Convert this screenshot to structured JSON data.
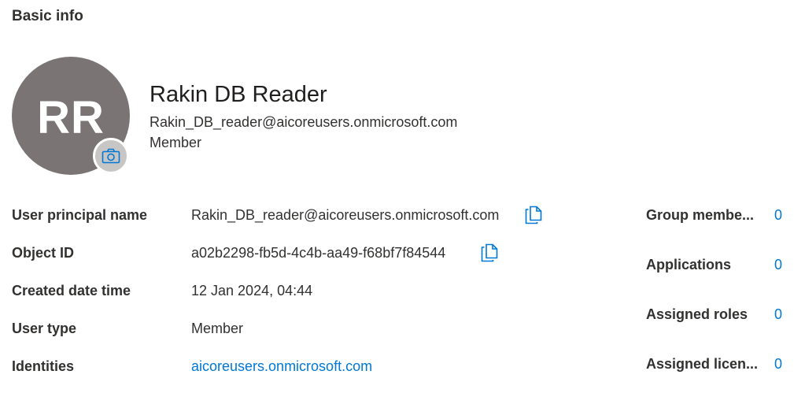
{
  "section": {
    "title": "Basic info"
  },
  "profile": {
    "initials": "RR",
    "name": "Rakin DB Reader",
    "email": "Rakin_DB_reader@aicoreusers.onmicrosoft.com",
    "role": "Member",
    "camera_icon": "camera-icon"
  },
  "properties": [
    {
      "label": "User principal name",
      "value": "Rakin_DB_reader@aicoreusers.onmicrosoft.com",
      "copy": true
    },
    {
      "label": "Object ID",
      "value": "a02b2298-fb5d-4c4b-aa49-f68bf7f84544",
      "copy": true
    },
    {
      "label": "Created date time",
      "value": "12 Jan 2024, 04:44"
    },
    {
      "label": "User type",
      "value": "Member"
    },
    {
      "label": "Identities",
      "value": "aicoreusers.onmicrosoft.com",
      "link": true
    }
  ],
  "stats": [
    {
      "label": "Group membe...",
      "value": "0"
    },
    {
      "label": "Applications",
      "value": "0"
    },
    {
      "label": "Assigned roles",
      "value": "0"
    },
    {
      "label": "Assigned licen...",
      "value": "0"
    }
  ],
  "colors": {
    "accent": "#0078d4",
    "avatar": "#7a7574",
    "text": "#323130"
  }
}
